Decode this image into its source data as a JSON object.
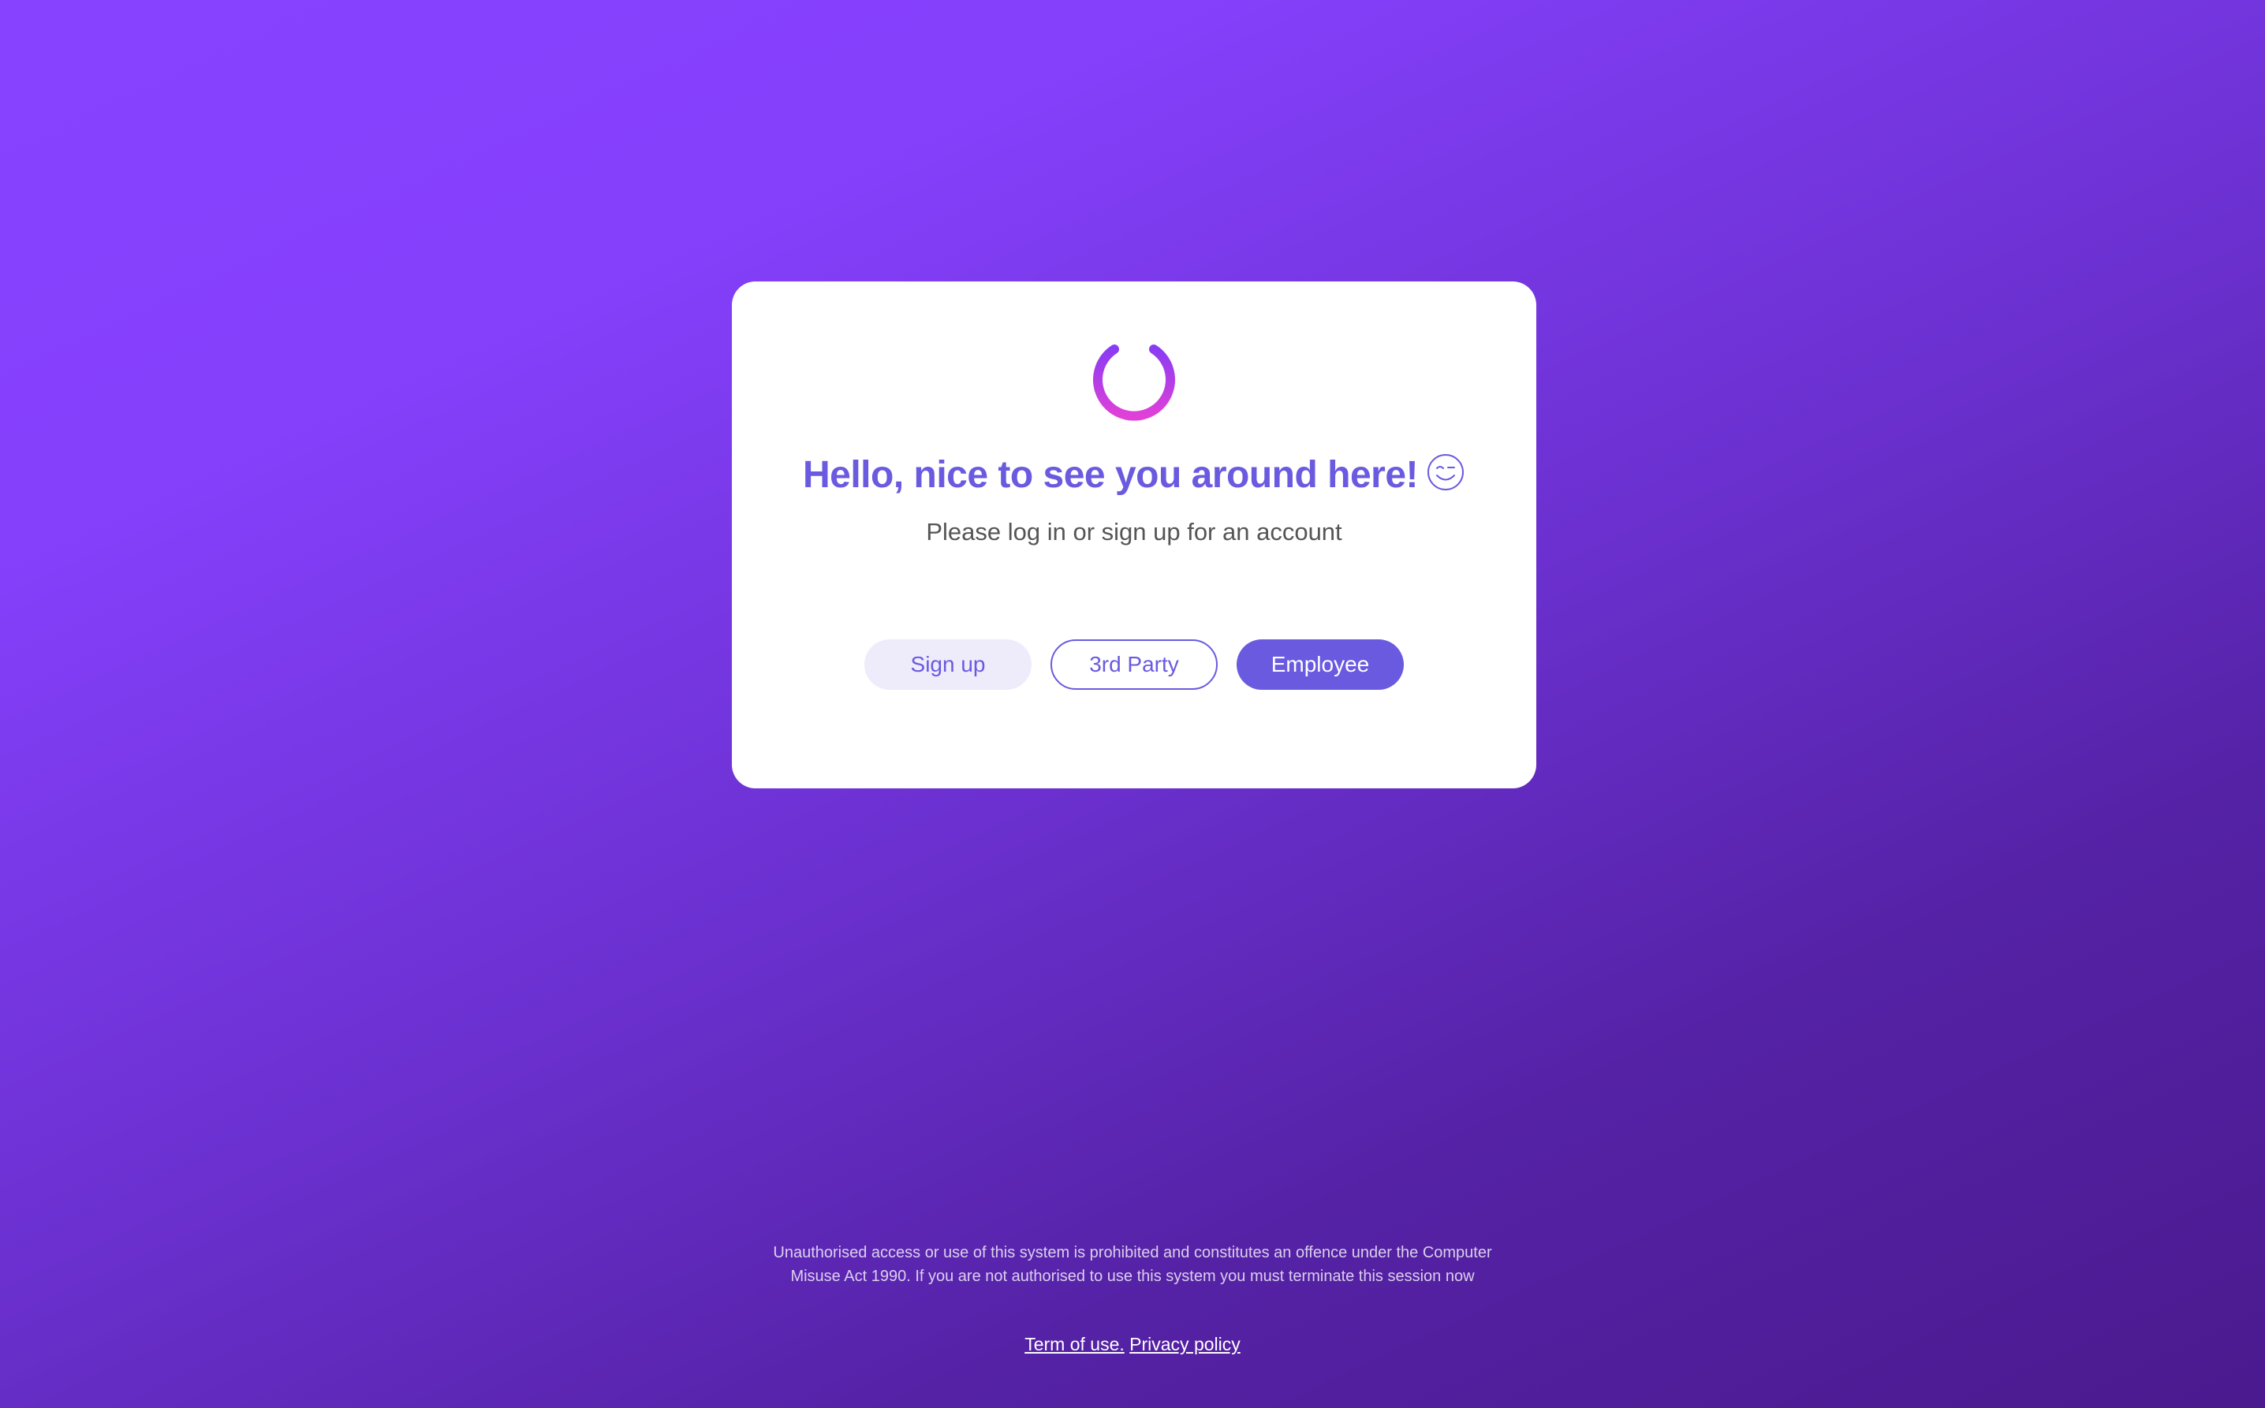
{
  "card": {
    "title": "Hello, nice to see you around here!",
    "subtitle": "Please log in or sign up for an account",
    "buttons": {
      "signup_label": "Sign up",
      "third_party_label": "3rd Party",
      "employee_label": "Employee"
    },
    "icons": {
      "logo": "power-icon",
      "title_emoji": "wink-icon"
    }
  },
  "footer": {
    "disclaimer_line1": "Unauthorised access or use of this system is prohibited and constitutes an offence under the Computer",
    "disclaimer_line2": "Misuse Act 1990. If you are not authorised to use this system you must terminate this session now",
    "terms_link": "Term of use.",
    "privacy_link": "Privacy policy"
  },
  "colors": {
    "accent": "#6a5ae0",
    "background_start": "#8742ff",
    "background_end": "#4b1a8e",
    "icon_gradient_top": "#8a3cf2",
    "icon_gradient_bottom": "#e040d8"
  }
}
